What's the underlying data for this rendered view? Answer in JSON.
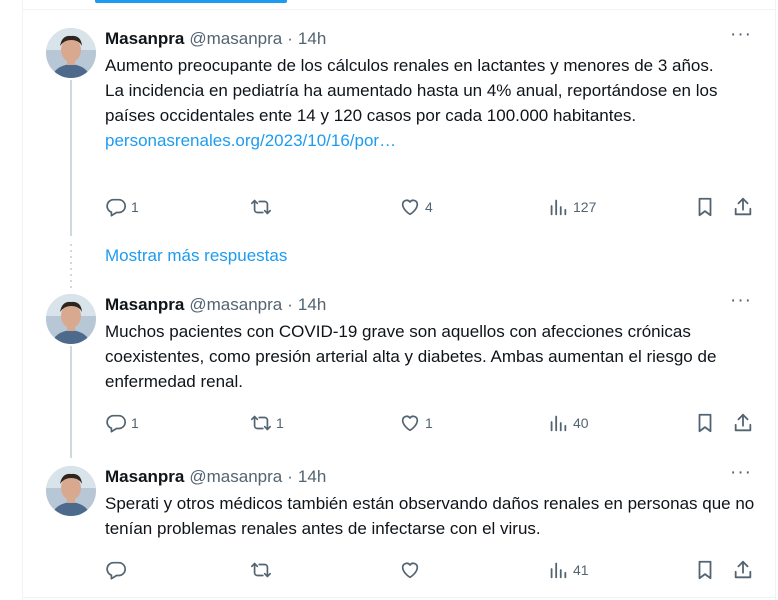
{
  "colors": {
    "accent": "#1d9bf0",
    "text": "#0f1419",
    "muted": "#536471",
    "border": "#eff3f4"
  },
  "tweets": [
    {
      "name": "Masanpra",
      "handle": "@masanpra",
      "separator": "·",
      "time": "14h",
      "more": "···",
      "text_lines": [
        "Aumento preocupante de los cálculos renales en lactantes y menores de 3 años.",
        "La incidencia en pediatría ha aumentado hasta un 4% anual, reportándose en los países occidentales ente 14 y 120 casos por cada 100.000 habitantes."
      ],
      "link": "personasrenales.org/2023/10/16/por…",
      "replies": "1",
      "reposts": "",
      "likes": "4",
      "views": "127"
    },
    {
      "name": "Masanpra",
      "handle": "@masanpra",
      "separator": "·",
      "time": "14h",
      "more": "···",
      "text": "Muchos pacientes con COVID-19 grave son aquellos con afecciones crónicas coexistentes, como presión arterial alta y diabetes. Ambas aumentan el riesgo de enfermedad renal.",
      "replies": "1",
      "reposts": "1",
      "likes": "1",
      "views": "40"
    },
    {
      "name": "Masanpra",
      "handle": "@masanpra",
      "separator": "·",
      "time": "14h",
      "more": "···",
      "text": "Sperati y otros médicos también están observando daños renales en personas que no tenían problemas renales antes de infectarse con el virus.",
      "replies": "",
      "reposts": "",
      "likes": "",
      "views": "41"
    }
  ],
  "show_more_replies": "Mostrar más respuestas",
  "icons": {
    "reply": "speech-bubble-icon",
    "repost": "repost-arrows-icon",
    "like": "heart-icon",
    "views": "bar-chart-icon",
    "bookmark": "bookmark-icon",
    "share": "share-upload-icon"
  }
}
